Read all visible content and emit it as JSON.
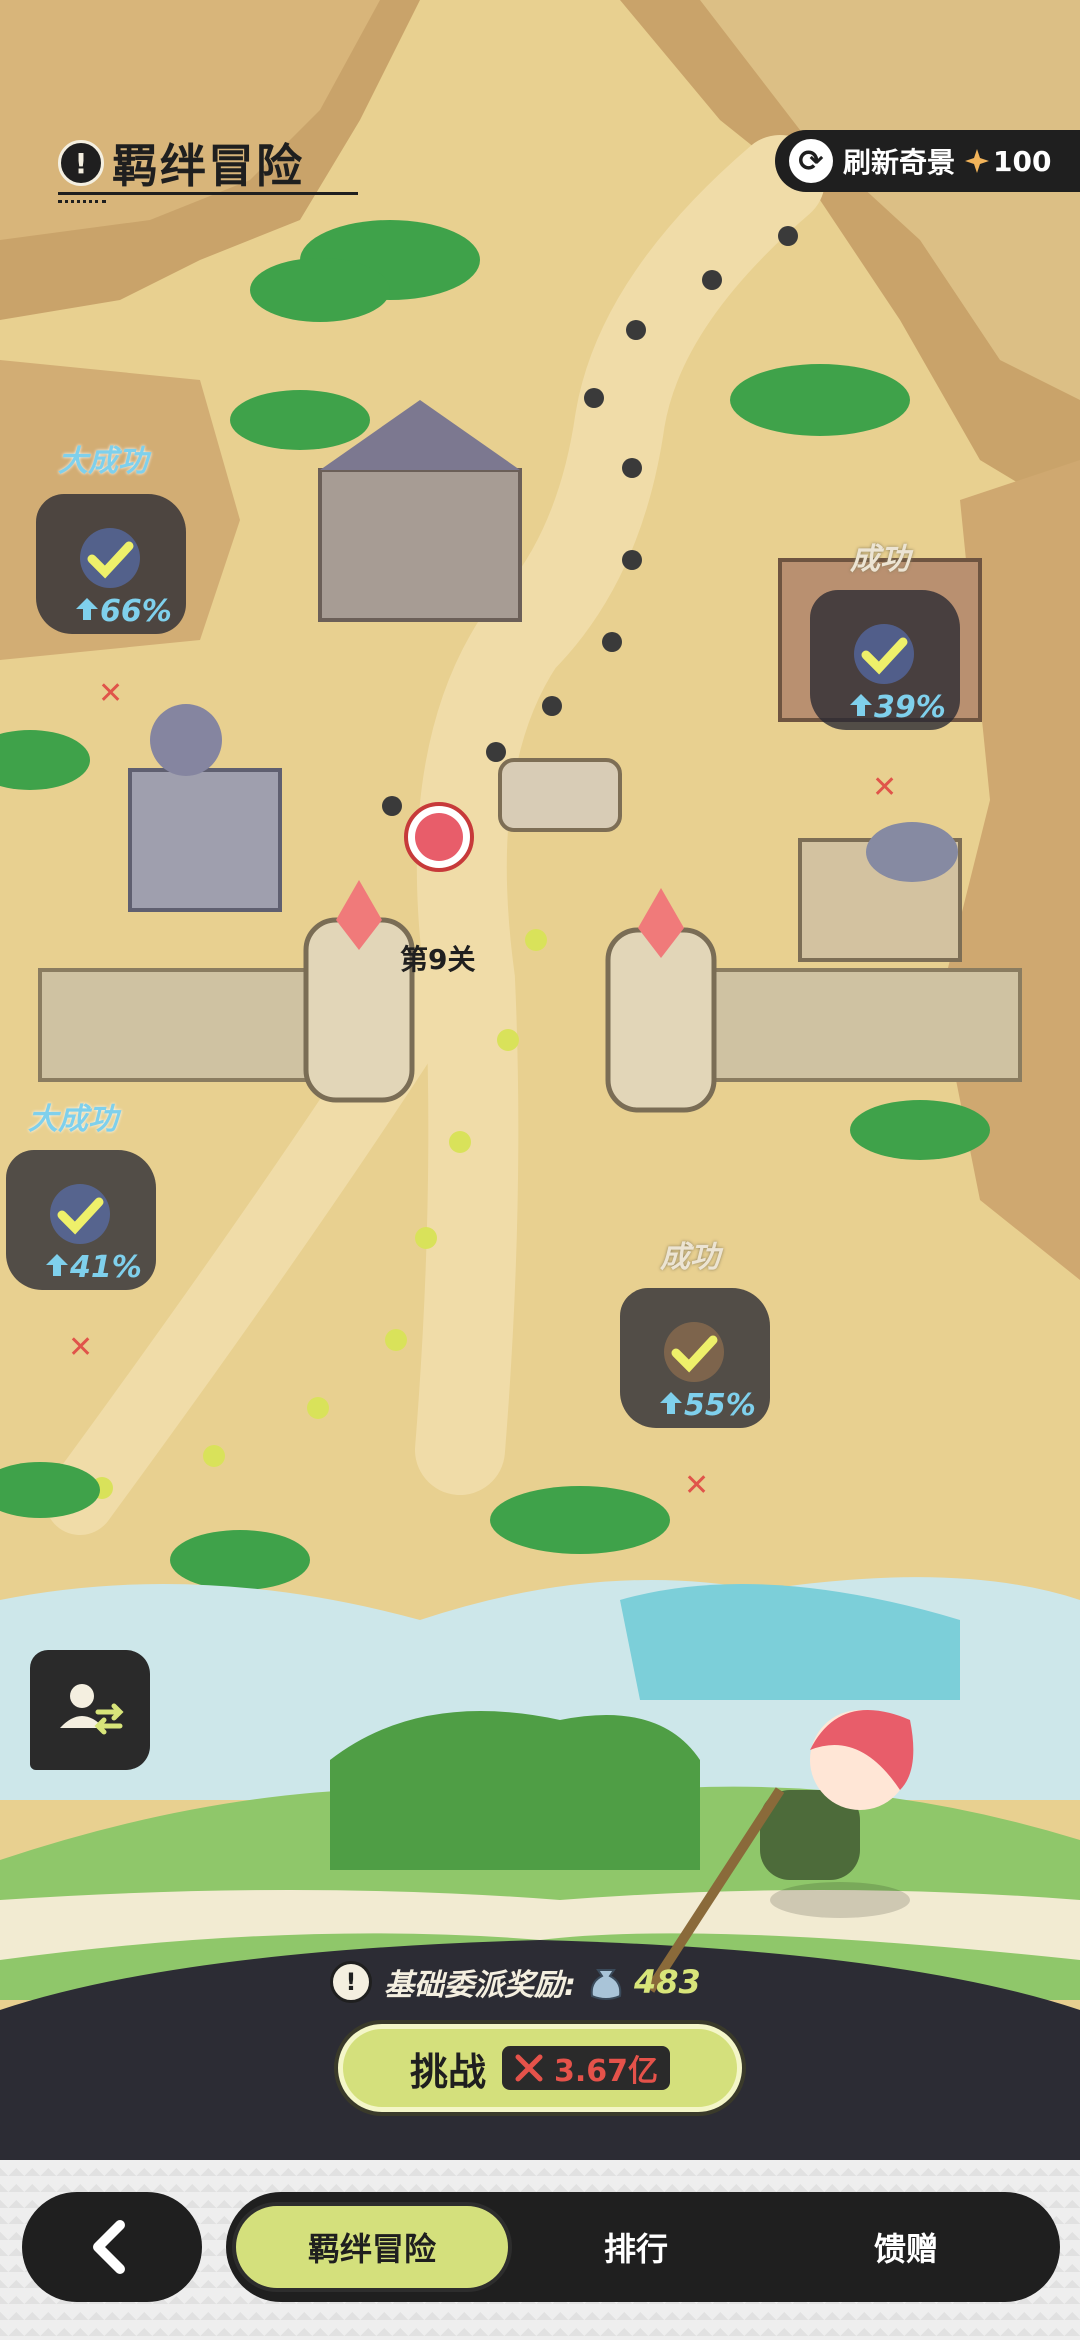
{
  "header": {
    "title": "羁绊冒险"
  },
  "refresh": {
    "label": "刷新奇景",
    "cost": "100"
  },
  "nodes": [
    {
      "status": "大成功",
      "percent": "66%"
    },
    {
      "status": "成功",
      "percent": "39%"
    },
    {
      "status": "大成功",
      "percent": "41%"
    },
    {
      "status": "成功",
      "percent": "55%"
    }
  ],
  "stage": {
    "label": "第9关"
  },
  "reward": {
    "label": "基础委派奖励:",
    "value": "483"
  },
  "challenge": {
    "label": "挑战",
    "power": "3.67亿"
  },
  "nav": {
    "tabs": [
      "羁绊冒险",
      "排行",
      "馈赠"
    ],
    "active_index": 0
  },
  "icons": {
    "title": "info-icon",
    "refresh": "refresh-icon",
    "currency": "star-gem-icon",
    "node": "check-icon",
    "back": "back-arrow-icon",
    "profile": "profile-swap-icon",
    "reward_item": "bag-icon",
    "power": "battle-power-icon"
  },
  "colors": {
    "accent": "#d4e07c",
    "dark": "#1f1f1f",
    "sand": "#e7cf8f",
    "power_red": "#e5524a",
    "success_blue": "#7fd0ec"
  }
}
